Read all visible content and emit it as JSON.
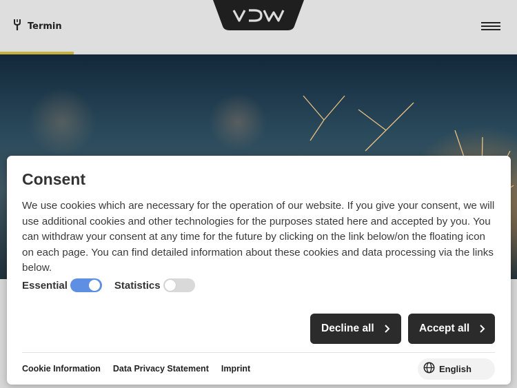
{
  "header": {
    "termin_label": "Termin",
    "logo_text": "VDW",
    "accent_color": "#c8b13a"
  },
  "consent": {
    "title": "Consent",
    "description": "We use cookies which are necessary for the operation of our website. If you give your consent, we will use additional cookies and other technologies for the purposes stated here and accepted by you. You can withdraw your consent at any time for the future by clicking on the link below/on the floating icon on each page. You can find detailed information about these cookies and data processing via the links below.",
    "toggles": [
      {
        "label": "Essential",
        "on": true
      },
      {
        "label": "Statistics",
        "on": false
      }
    ],
    "decline_label": "Decline all",
    "accept_label": "Accept all",
    "footer_links": [
      "Cookie Information",
      "Data Privacy Statement",
      "Imprint"
    ],
    "language": "English",
    "toggle_on_color": "#5e8fe2",
    "button_color": "#2b2b2b"
  }
}
